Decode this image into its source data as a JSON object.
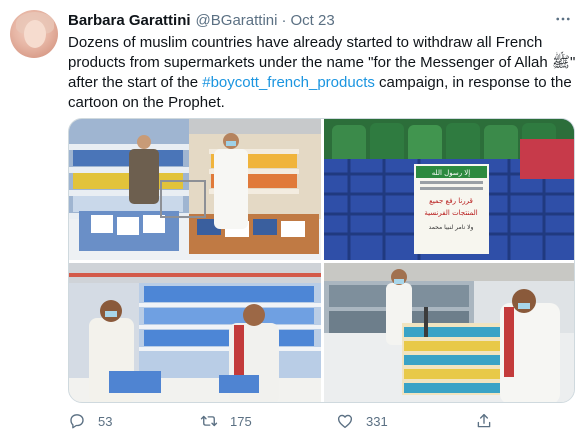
{
  "tweet": {
    "author_name": "Barbara Garattini",
    "author_handle": "@BGarattini",
    "separator": "·",
    "date": "Oct 23",
    "text_before": "Dozens of muslim countries have already started to withdraw all French products from supermarkets under the name \"for the Messenger of Allah ﷺ\" after the start of the ",
    "hashtag": "#boycott_french_products",
    "text_after": " campaign, in response to the cartoon on the Prophet."
  },
  "media": {
    "photo_sign_lines": [
      "إلا رسول الله",
      "قررنا رفع جميع",
      "المنتجات الفرنسية",
      "ولا نامر لنبيا محمد"
    ]
  },
  "actions": {
    "replies": "53",
    "retweets": "175",
    "likes": "331"
  },
  "icons": [
    "more-icon",
    "reply-icon",
    "retweet-icon",
    "like-icon",
    "share-icon"
  ],
  "colors": {
    "text": "#0f1419",
    "secondary": "#5b7083",
    "hashtag": "#1b95e0",
    "border": "#cfd9de"
  }
}
